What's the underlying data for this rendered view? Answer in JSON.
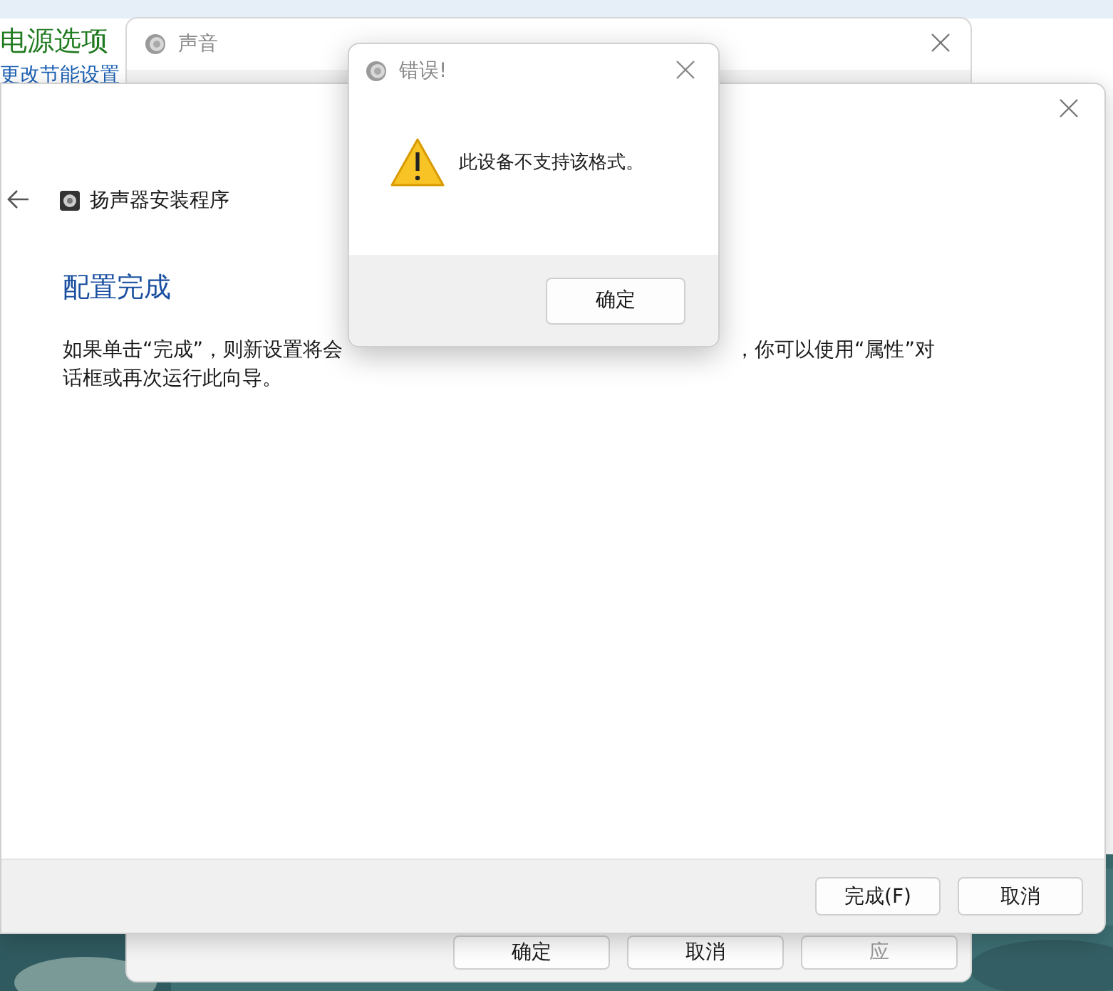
{
  "power_options_window": {
    "title": "电源选项",
    "link": "更改节能设置"
  },
  "sound_window": {
    "title": "声音",
    "buttons": [
      "确定",
      "取消",
      "应"
    ]
  },
  "speaker_setup_window": {
    "title": "扬声器安装程序",
    "heading": "配置完成",
    "paragraph_line_1_left": "如果单击“完成”，则新设置将会",
    "paragraph_line_1_right": "，你可以使用“属性”对",
    "paragraph_line_2": "话框或再次运行此向导。",
    "buttons": [
      "完成(F)",
      "取消"
    ]
  },
  "error_dialog": {
    "title": "错误!",
    "message": "此设备不支持该格式。",
    "buttons": [
      "确定"
    ]
  }
}
